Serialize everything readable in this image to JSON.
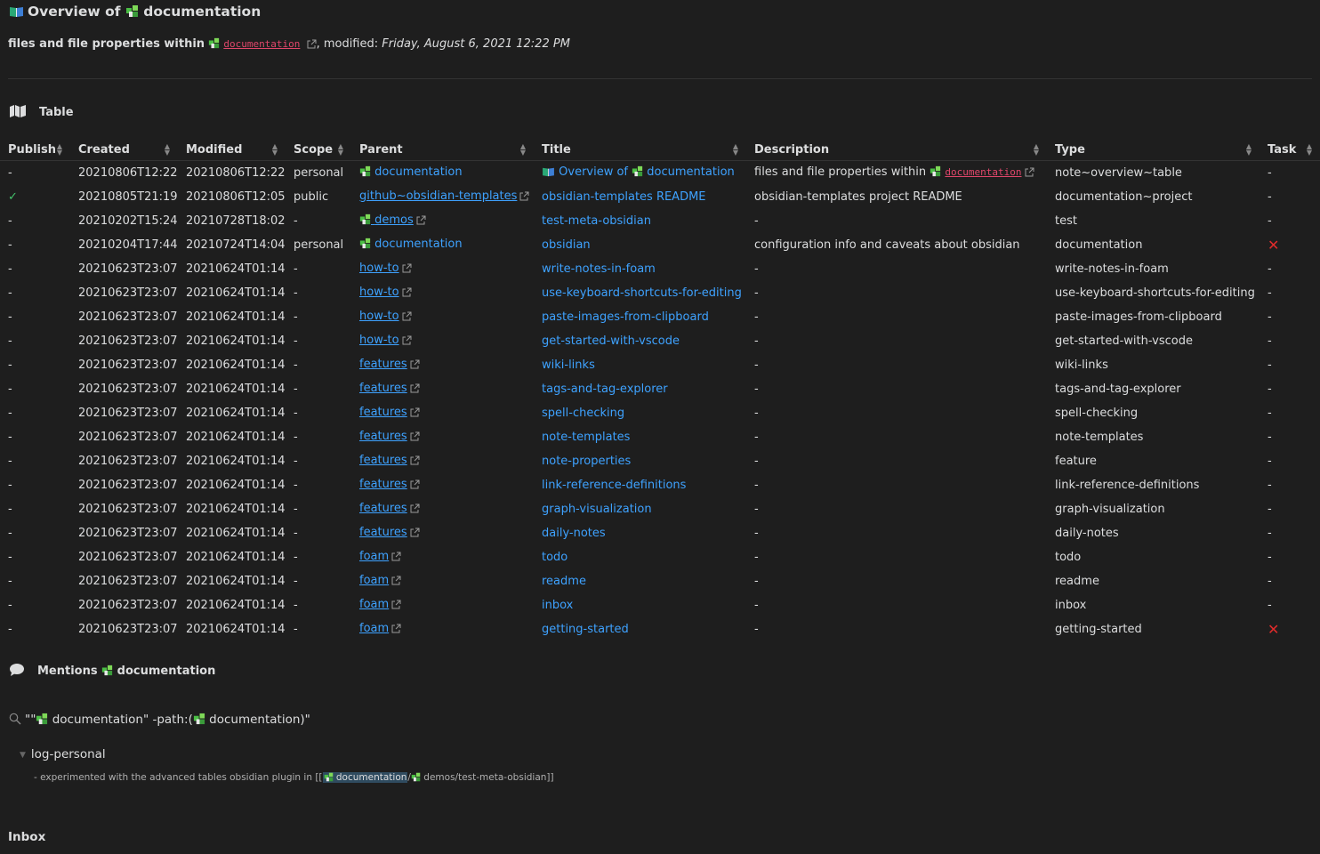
{
  "heading": {
    "prefix": "Overview of",
    "name": "documentation"
  },
  "subtitle": {
    "prefix": "files and file properties within",
    "link": "documentation",
    "modified_label": ", modified:",
    "modified_value": "Friday, August 6, 2021 12:22 PM"
  },
  "table_section": {
    "label": "Table"
  },
  "columns": [
    "Publish",
    "Created",
    "Modified",
    "Scope",
    "Parent",
    "Title",
    "Description",
    "Type",
    "Task"
  ],
  "rows": [
    {
      "publish": "-",
      "created": "20210806T12:22",
      "modified": "20210806T12:22",
      "scope": "personal",
      "parent": "documentation",
      "parent_style": "puzzle",
      "title": "Overview of",
      "title_suffix": "documentation",
      "title_style": "overview",
      "description": "files and file properties within",
      "desc_link": "documentation",
      "type": "note~overview~table",
      "task": "-"
    },
    {
      "publish": "✓",
      "created": "20210805T21:19",
      "modified": "20210806T12:05",
      "scope": "public",
      "parent": "github~obsidian-templates",
      "parent_style": "ext",
      "title": "obsidian-templates README",
      "description": "obsidian-templates project README",
      "type": "documentation~project",
      "task": "-"
    },
    {
      "publish": "-",
      "created": "20210202T15:24",
      "modified": "20210728T18:02",
      "scope": "-",
      "parent": "demos",
      "parent_style": "puzzle-ext",
      "title": "test-meta-obsidian",
      "description": "-",
      "type": "test",
      "task": "-"
    },
    {
      "publish": "-",
      "created": "20210204T17:44",
      "modified": "20210724T14:04",
      "scope": "personal",
      "parent": "documentation",
      "parent_style": "puzzle",
      "title": "obsidian",
      "description": "configuration info and caveats about obsidian",
      "type": "documentation",
      "task": "✕"
    },
    {
      "publish": "-",
      "created": "20210623T23:07",
      "modified": "20210624T01:14",
      "scope": "-",
      "parent": "how-to",
      "parent_style": "ext",
      "title": "write-notes-in-foam",
      "description": "-",
      "type": "write-notes-in-foam",
      "task": "-"
    },
    {
      "publish": "-",
      "created": "20210623T23:07",
      "modified": "20210624T01:14",
      "scope": "-",
      "parent": "how-to",
      "parent_style": "ext",
      "title": "use-keyboard-shortcuts-for-editing",
      "description": "-",
      "type": "use-keyboard-shortcuts-for-editing",
      "task": "-"
    },
    {
      "publish": "-",
      "created": "20210623T23:07",
      "modified": "20210624T01:14",
      "scope": "-",
      "parent": "how-to",
      "parent_style": "ext",
      "title": "paste-images-from-clipboard",
      "description": "-",
      "type": "paste-images-from-clipboard",
      "task": "-"
    },
    {
      "publish": "-",
      "created": "20210623T23:07",
      "modified": "20210624T01:14",
      "scope": "-",
      "parent": "how-to",
      "parent_style": "ext",
      "title": "get-started-with-vscode",
      "description": "-",
      "type": "get-started-with-vscode",
      "task": "-"
    },
    {
      "publish": "-",
      "created": "20210623T23:07",
      "modified": "20210624T01:14",
      "scope": "-",
      "parent": "features",
      "parent_style": "ext",
      "title": "wiki-links",
      "description": "-",
      "type": "wiki-links",
      "task": "-"
    },
    {
      "publish": "-",
      "created": "20210623T23:07",
      "modified": "20210624T01:14",
      "scope": "-",
      "parent": "features",
      "parent_style": "ext",
      "title": "tags-and-tag-explorer",
      "description": "-",
      "type": "tags-and-tag-explorer",
      "task": "-"
    },
    {
      "publish": "-",
      "created": "20210623T23:07",
      "modified": "20210624T01:14",
      "scope": "-",
      "parent": "features",
      "parent_style": "ext",
      "title": "spell-checking",
      "description": "-",
      "type": "spell-checking",
      "task": "-"
    },
    {
      "publish": "-",
      "created": "20210623T23:07",
      "modified": "20210624T01:14",
      "scope": "-",
      "parent": "features",
      "parent_style": "ext",
      "title": "note-templates",
      "description": "-",
      "type": "note-templates",
      "task": "-"
    },
    {
      "publish": "-",
      "created": "20210623T23:07",
      "modified": "20210624T01:14",
      "scope": "-",
      "parent": "features",
      "parent_style": "ext",
      "title": "note-properties",
      "description": "-",
      "type": "feature",
      "task": "-"
    },
    {
      "publish": "-",
      "created": "20210623T23:07",
      "modified": "20210624T01:14",
      "scope": "-",
      "parent": "features",
      "parent_style": "ext",
      "title": "link-reference-definitions",
      "description": "-",
      "type": "link-reference-definitions",
      "task": "-"
    },
    {
      "publish": "-",
      "created": "20210623T23:07",
      "modified": "20210624T01:14",
      "scope": "-",
      "parent": "features",
      "parent_style": "ext",
      "title": "graph-visualization",
      "description": "-",
      "type": "graph-visualization",
      "task": "-"
    },
    {
      "publish": "-",
      "created": "20210623T23:07",
      "modified": "20210624T01:14",
      "scope": "-",
      "parent": "features",
      "parent_style": "ext",
      "title": "daily-notes",
      "description": "-",
      "type": "daily-notes",
      "task": "-"
    },
    {
      "publish": "-",
      "created": "20210623T23:07",
      "modified": "20210624T01:14",
      "scope": "-",
      "parent": "foam",
      "parent_style": "ext",
      "title": "todo",
      "description": "-",
      "type": "todo",
      "task": "-"
    },
    {
      "publish": "-",
      "created": "20210623T23:07",
      "modified": "20210624T01:14",
      "scope": "-",
      "parent": "foam",
      "parent_style": "ext",
      "title": "readme",
      "description": "-",
      "type": "readme",
      "task": "-"
    },
    {
      "publish": "-",
      "created": "20210623T23:07",
      "modified": "20210624T01:14",
      "scope": "-",
      "parent": "foam",
      "parent_style": "ext",
      "title": "inbox",
      "description": "-",
      "type": "inbox",
      "task": "-"
    },
    {
      "publish": "-",
      "created": "20210623T23:07",
      "modified": "20210624T01:14",
      "scope": "-",
      "parent": "foam",
      "parent_style": "ext",
      "title": "getting-started",
      "description": "-",
      "type": "getting-started",
      "task": "✕"
    }
  ],
  "mentions": {
    "label": "Mentions",
    "name": "documentation"
  },
  "search": {
    "q_open": "\"\"",
    "q_name": "documentation",
    "q_mid": "\" -path:(",
    "q_name2": "documentation",
    "q_close": ")\""
  },
  "result": {
    "file": "log-personal",
    "snippet_prefix": "- experimented with the advanced tables obsidian plugin in [[",
    "snippet_highlight": "documentation",
    "snippet_sep": "/",
    "snippet_rest": "demos/test-meta-obsidian]]"
  },
  "inbox": {
    "label": "Inbox"
  },
  "colors": {
    "background": "#1e1e1e",
    "text": "#dcddde",
    "link": "#3ea2ff",
    "code_link": "#e0466a",
    "check": "#44c26c",
    "cross": "#e02b2b"
  },
  "icons": {
    "heading": "open-book-icon",
    "note": "puzzle-piece-icon",
    "table": "map-icon",
    "mentions": "speech-bubble-icon",
    "search": "magnifier-icon",
    "external": "external-link-icon"
  }
}
